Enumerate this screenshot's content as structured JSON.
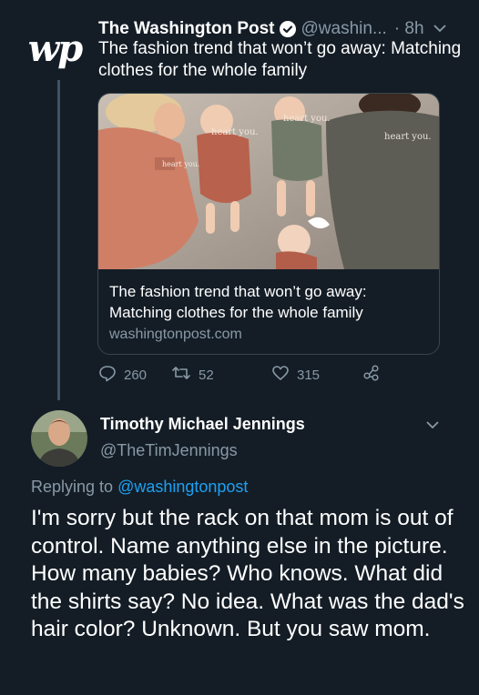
{
  "tweet": {
    "author_logo": "𝔴𝔭",
    "author_name": "The Washington Post",
    "handle": "@washin...",
    "time": "· 8h",
    "text": "The fashion trend that won’t go away: Matching clothes for the whole family",
    "card": {
      "title": "The fashion trend that won’t go away: Matching clothes for the whole family",
      "domain": "washingtonpost.com",
      "shirt_text": "heart you."
    },
    "counts": {
      "replies": "260",
      "retweets": "52",
      "likes": "315"
    }
  },
  "reply": {
    "author_name": "Timothy Michael Jennings",
    "handle": "@TheTimJennings",
    "replying_prefix": "Replying to",
    "replying_to": "@washingtonpost",
    "text": "I'm sorry but the rack on that mom is out of control. Name anything else in the picture. How many babies? Who knows. What did the shirts say? No idea. What was the dad's hair color? Unknown. But you saw mom."
  },
  "colors": {
    "background": "#141d26",
    "secondary_text": "#8899a6",
    "link": "#1da1f2",
    "border": "#38444d"
  },
  "icons": [
    "wp-logo-icon",
    "verified-icon",
    "chevron-down-icon",
    "reply-icon",
    "retweet-icon",
    "like-icon",
    "share-icon"
  ]
}
